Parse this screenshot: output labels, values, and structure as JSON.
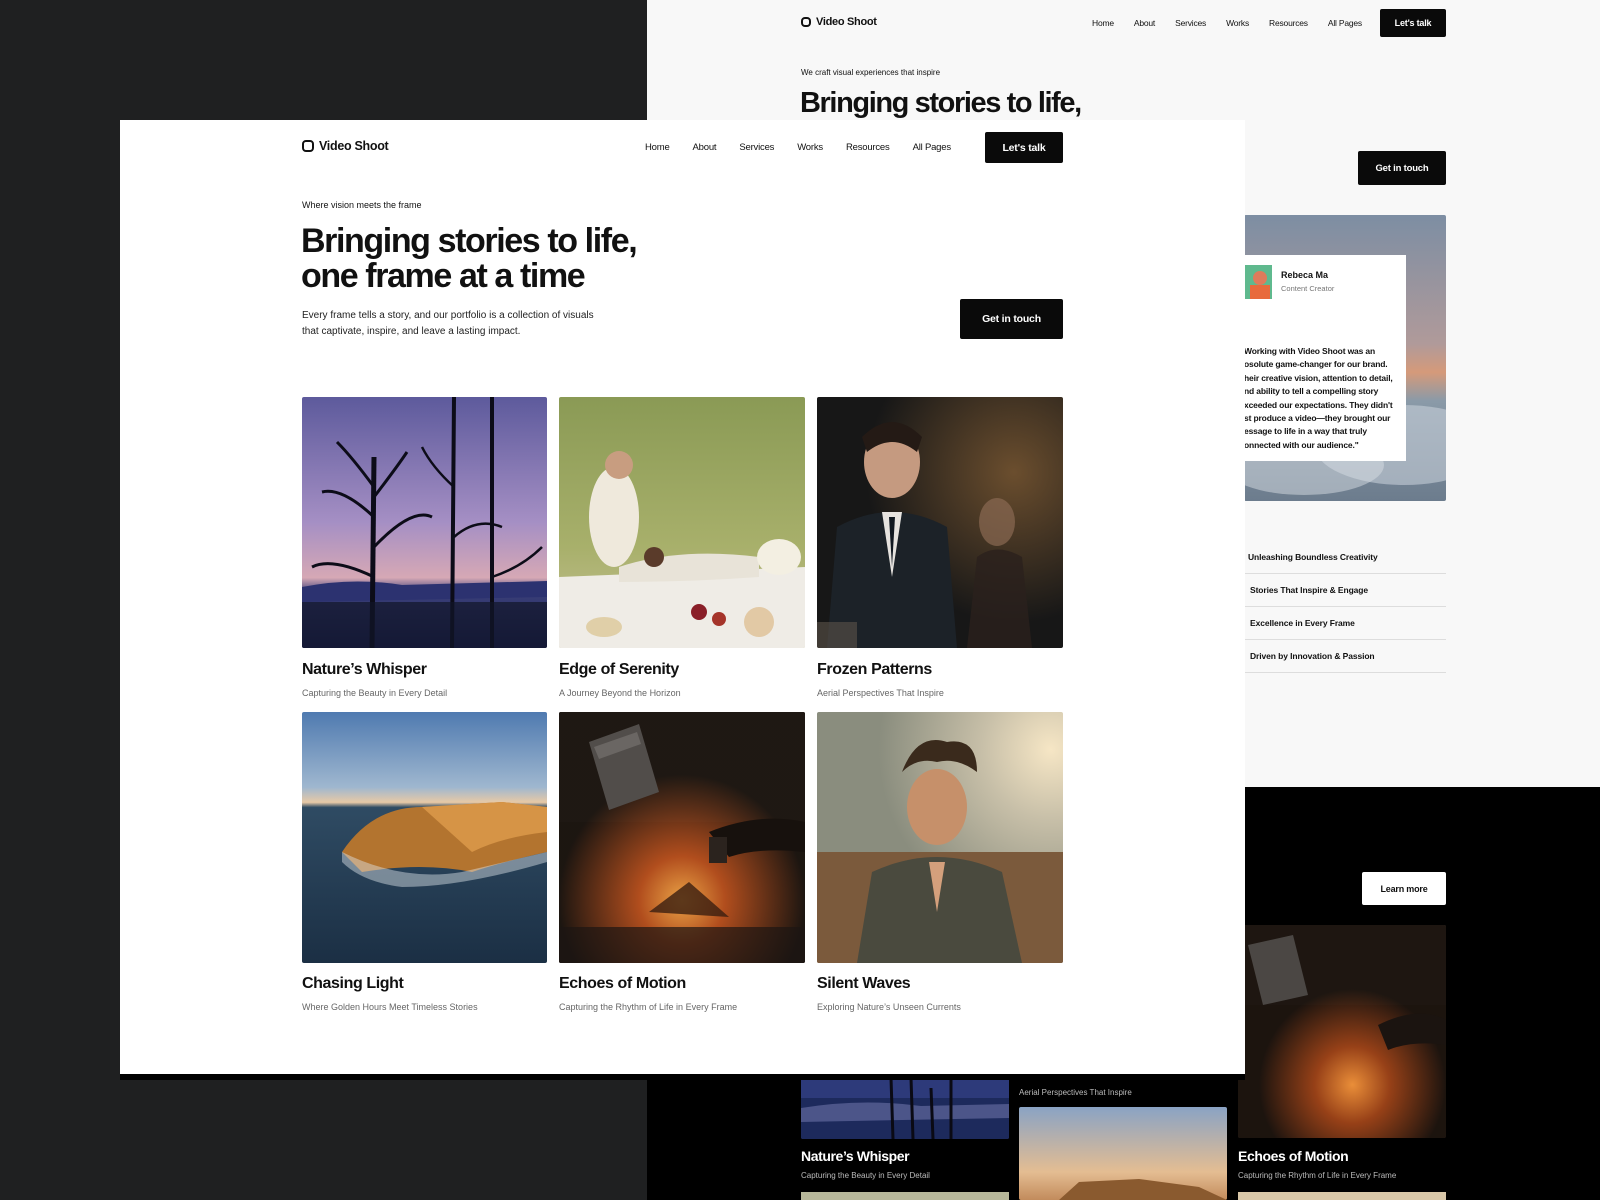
{
  "back_page": {
    "logo": "Video Shoot",
    "nav": [
      "Home",
      "About",
      "Services",
      "Works",
      "Resources",
      "All Pages"
    ],
    "cta": "Let's talk",
    "tagline": "We craft visual experiences that inspire",
    "headline": "Bringing stories to life,",
    "get_in_touch": "Get in touch",
    "testimonial": {
      "name": "Rebeca Ma",
      "role": "Content Creator",
      "quote_lines": [
        "Working with Video Shoot was an",
        "osolute game-changer for our brand.",
        "heir creative vision, attention to detail,",
        "nd ability to tell a compelling story",
        "xceeded our expectations. They didn't",
        "st produce a video—they brought our",
        "essage to life in a way that truly",
        "onnected with our audience.\""
      ]
    },
    "features": [
      "Unleashing Boundless Creativity",
      "Stories That Inspire & Engage",
      "Excellence in Every Frame",
      "Driven by Innovation & Passion"
    ],
    "learn_more": "Learn more",
    "cards": [
      {
        "title": "Nature’s Whisper",
        "subtitle": "Capturing the Beauty in Every Detail"
      },
      {
        "title": "",
        "subtitle": "Aerial Perspectives That Inspire"
      },
      {
        "title": "Echoes of Motion",
        "subtitle": "Capturing the Rhythm of Life in Every Frame"
      }
    ]
  },
  "front_page": {
    "logo": "Video Shoot",
    "nav": [
      "Home",
      "About",
      "Services",
      "Works",
      "Resources",
      "All Pages"
    ],
    "cta": "Let's talk",
    "tagline": "Where vision meets the frame",
    "headline_line1": "Bringing stories to life,",
    "headline_line2": "one frame at a time",
    "description_line1": "Every frame tells a story, and our portfolio is a collection of visuals",
    "description_line2": "that captivate, inspire, and leave a lasting impact.",
    "get_in_touch": "Get in touch",
    "works": [
      {
        "title": "Nature’s Whisper",
        "subtitle": "Capturing the Beauty in Every Detail"
      },
      {
        "title": "Edge of Serenity",
        "subtitle": "A Journey Beyond the Horizon"
      },
      {
        "title": "Frozen Patterns",
        "subtitle": "Aerial Perspectives That Inspire"
      },
      {
        "title": "Chasing Light",
        "subtitle": "Where Golden Hours Meet Timeless Stories"
      },
      {
        "title": "Echoes of Motion",
        "subtitle": "Capturing the Rhythm of Life in Every Frame"
      },
      {
        "title": "Silent Waves",
        "subtitle": "Exploring Nature’s Unseen Currents"
      }
    ]
  },
  "colors": {
    "canvas": "#1f2021",
    "dark": "#0a0a0a",
    "back_bg": "#f8f8f8",
    "front_bg": "#ffffff"
  }
}
